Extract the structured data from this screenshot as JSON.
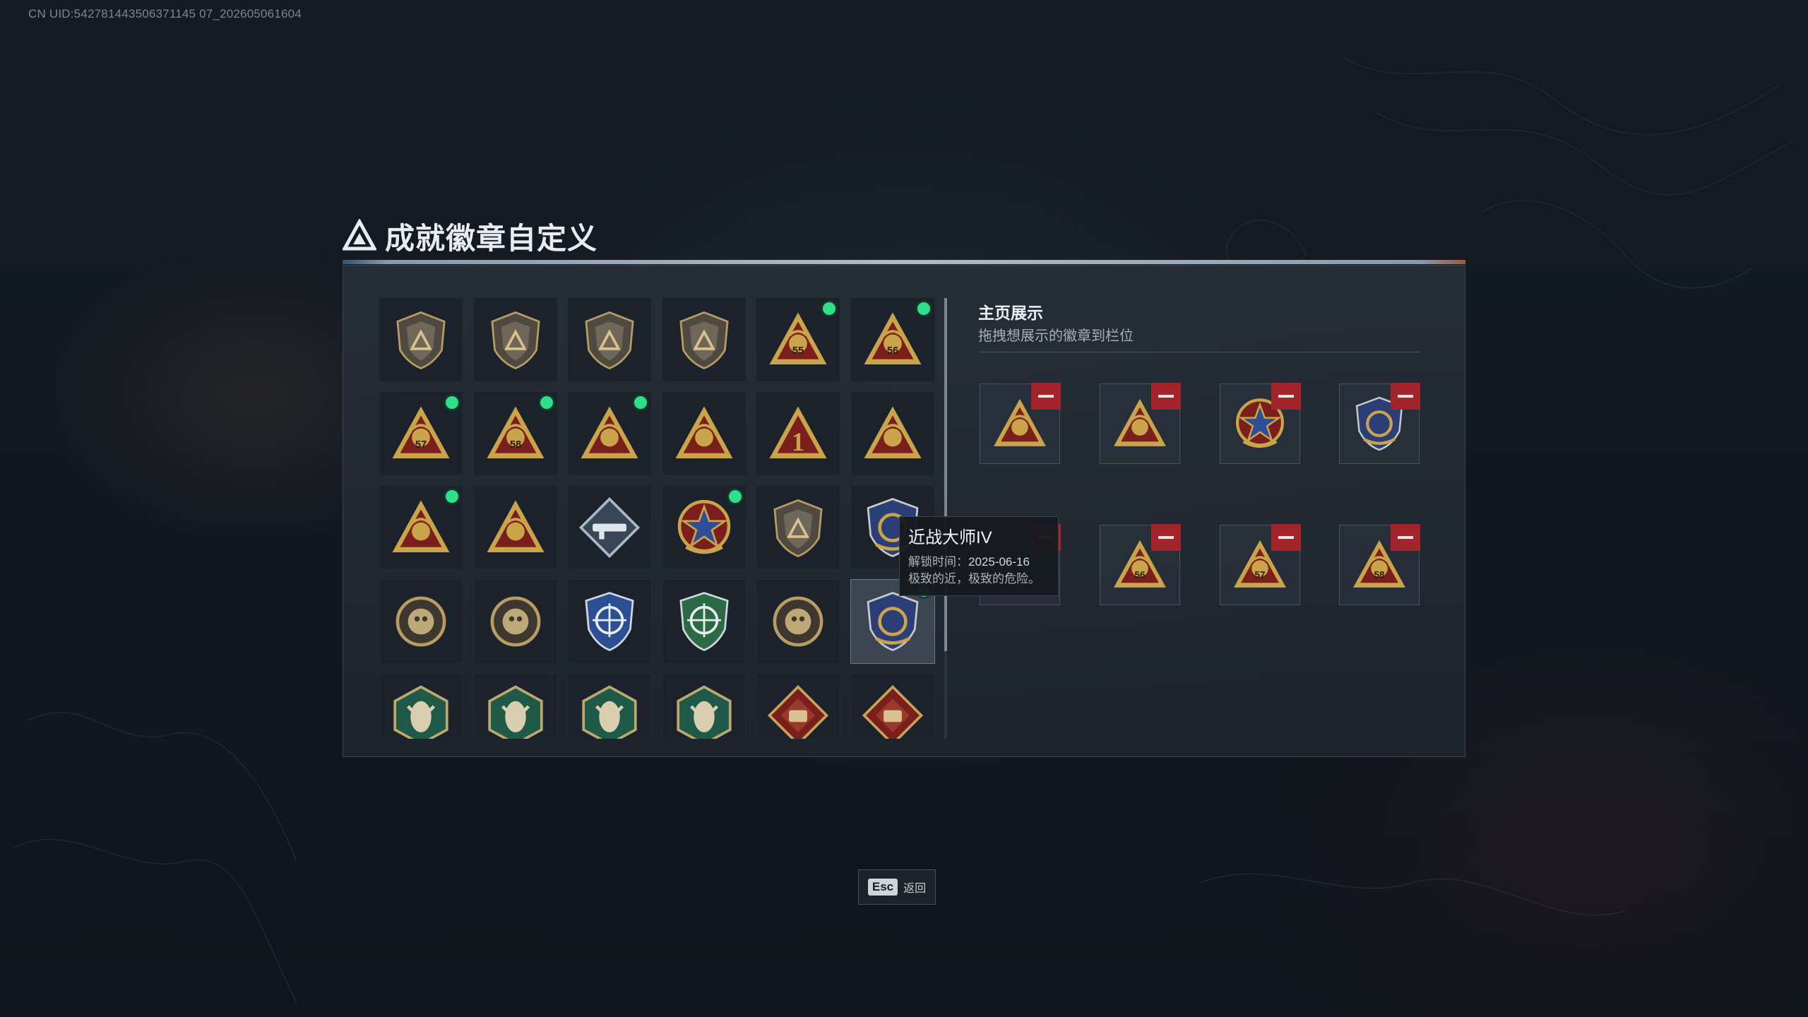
{
  "uid": "CN UID:542781443506371145 07_202605061604",
  "page_title": "成就徽章自定义",
  "badge_grid": [
    {
      "icon": "shield-triangle-badge-icon",
      "new": false
    },
    {
      "icon": "helicopter-shield-badge-icon",
      "new": false
    },
    {
      "icon": "diamond-shield-badge-icon",
      "new": false
    },
    {
      "icon": "arrow-shield-badge-icon",
      "new": false
    },
    {
      "icon": "bag-55-badge-icon",
      "new": true,
      "text": "55"
    },
    {
      "icon": "trophy-56-badge-icon",
      "new": true,
      "text": "56"
    },
    {
      "icon": "canister-57-badge-icon",
      "new": true,
      "text": "57"
    },
    {
      "icon": "vehicle-58-badge-icon",
      "new": true,
      "text": "58"
    },
    {
      "icon": "trophy-cup-badge-icon",
      "new": true
    },
    {
      "icon": "boat-badge-icon",
      "new": false
    },
    {
      "icon": "number-one-badge-icon",
      "new": false,
      "text": "1"
    },
    {
      "icon": "operator-badge-icon",
      "new": false
    },
    {
      "icon": "hands-badge-icon",
      "new": true
    },
    {
      "icon": "beast-badge-icon",
      "new": false
    },
    {
      "icon": "launcher-diamond-badge-icon",
      "new": false
    },
    {
      "icon": "star-medal-badge-icon",
      "new": true
    },
    {
      "icon": "chevron-shield-badge-icon",
      "new": false
    },
    {
      "icon": "police-badge-icon",
      "new": false
    },
    {
      "icon": "soldier-round-badge-icon",
      "new": false
    },
    {
      "icon": "skull-round-badge-icon",
      "new": false
    },
    {
      "icon": "blue-crosshair-badge-icon",
      "new": false
    },
    {
      "icon": "green-crosshair-badge-icon",
      "new": false
    },
    {
      "icon": "rifle-round-badge-icon",
      "new": false
    },
    {
      "icon": "melee-master-badge-icon",
      "new": true,
      "selected": true
    },
    {
      "icon": "wasp-badge-icon",
      "new": false
    },
    {
      "icon": "wasp-badge-icon",
      "new": false
    },
    {
      "icon": "missile-badge-icon",
      "new": false
    },
    {
      "icon": "climber-badge-icon",
      "new": false
    },
    {
      "icon": "dragon-badge-icon",
      "new": false
    },
    {
      "icon": "tank-badge-icon",
      "new": false
    }
  ],
  "showcase": {
    "title": "主页展示",
    "subtitle": "拖拽想展示的徽章到栏位",
    "slots": [
      {
        "icon": "hands-badge-icon"
      },
      {
        "icon": "trophy-cup-badge-icon"
      },
      {
        "icon": "star-medal-badge-icon"
      },
      {
        "icon": "melee-master-badge-icon"
      },
      {
        "icon": "hidden-under-tooltip-icon"
      },
      {
        "icon": "trophy-56-badge-icon",
        "text": "56"
      },
      {
        "icon": "canister-57-badge-icon",
        "text": "57"
      },
      {
        "icon": "vehicle-58-badge-icon",
        "text": "58"
      }
    ]
  },
  "tooltip": {
    "name": "近战大师IV",
    "unlock_label": "解锁时间：",
    "unlock_date": "2025-06-16",
    "description": "极致的近，极致的危险。"
  },
  "footer": {
    "esc_key": "Esc",
    "esc_label": "返回"
  },
  "colors": {
    "new_dot": "#2fe08a",
    "remove_button": "#a4242b",
    "badge_gold": "#c9a44a",
    "badge_red": "#7a1f1c"
  }
}
